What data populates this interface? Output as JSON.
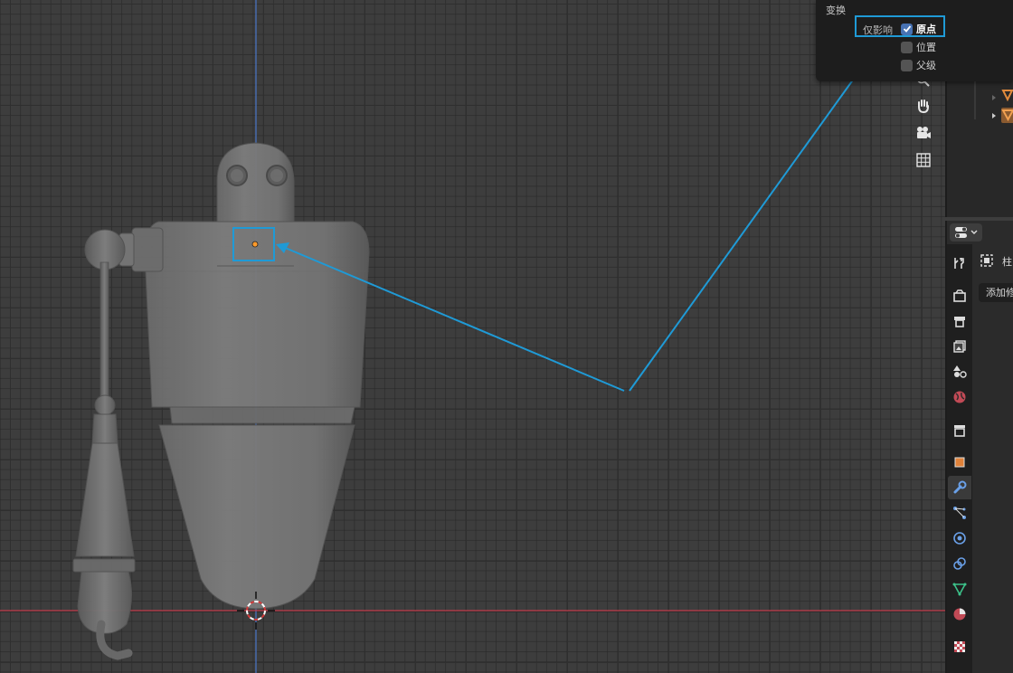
{
  "popup": {
    "title": "变换",
    "affect_only_label": "仅影响",
    "options": [
      {
        "label": "原点",
        "checked": true
      },
      {
        "label": "位置",
        "checked": false
      },
      {
        "label": "父级",
        "checked": false
      }
    ]
  },
  "properties": {
    "modifier_name": "柱",
    "add_modifier_label": "添加修"
  },
  "colors": {
    "highlight": "#1f9ad6",
    "x_axis": "#c23c4b",
    "y_axis": "#4a76c9",
    "checkbox_on": "#4772b3",
    "object_origin": "#ff9a2a"
  },
  "icons": {
    "nav": [
      "zoom-icon",
      "hand-pan-icon",
      "camera-icon",
      "grid-view-icon"
    ],
    "property_tabs": [
      "tool-icon",
      "render-icon",
      "output-icon",
      "view-layer-icon",
      "scene-icon",
      "world-icon",
      "collection-icon",
      "object-icon",
      "modifier-wrench-icon",
      "particles-icon",
      "physics-icon",
      "constraints-icon",
      "object-data-icon",
      "material-icon",
      "texture-icon"
    ]
  }
}
